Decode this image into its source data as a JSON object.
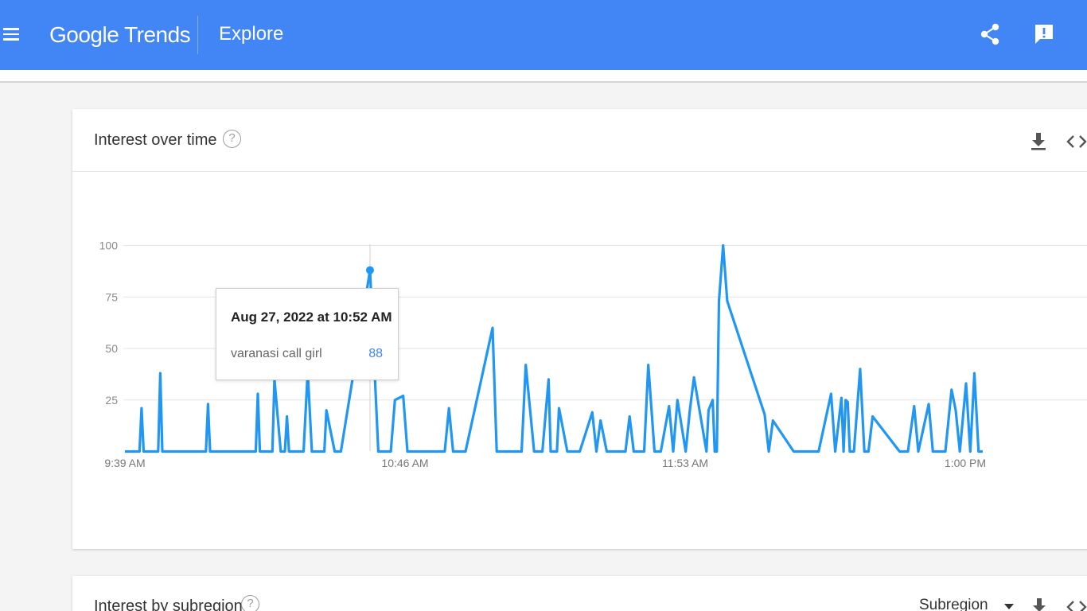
{
  "header": {
    "logo_google": "Google",
    "logo_trends": "Trends",
    "section": "Explore",
    "brand_color": "#4285f4",
    "icons": [
      "menu-icon",
      "share-icon",
      "feedback-icon"
    ]
  },
  "interest_card": {
    "title": "Interest over time",
    "help_symbol": "?",
    "icons": [
      "download-icon",
      "embed-icon"
    ]
  },
  "tooltip": {
    "date": "Aug 27, 2022 at 10:52 AM",
    "term": "varanasi call girl",
    "value": "88"
  },
  "chart_data": {
    "type": "line",
    "xlabel": "",
    "ylabel": "",
    "ylim": [
      0,
      100
    ],
    "y_ticks": [
      "100",
      "75",
      "50",
      "25"
    ],
    "x_ticks": [
      "9:39 AM",
      "10:46 AM",
      "11:53 AM",
      "1:00 PM"
    ],
    "grid": true,
    "color": "#2196f3",
    "highlighted_point": {
      "x": 731,
      "y": 88
    },
    "x": [
      0,
      7,
      8,
      9,
      16,
      17,
      18,
      35,
      39,
      40,
      41,
      44,
      61,
      63,
      64,
      65,
      69,
      71,
      72,
      75,
      77,
      78,
      79,
      80,
      81,
      82,
      86,
      88,
      90,
      93,
      94,
      96,
      97,
      101,
      103,
      104,
      118,
      122,
      124,
      128,
      130,
      134,
      136,
      140,
      154,
      156,
      158,
      160,
      162,
      164,
      177,
      179,
      181,
      189,
      191,
      193,
      197,
      200,
      201,
      204,
      205,
      206,
      208,
      209,
      213,
      217,
      219,
      225,
      227,
      229,
      232,
      234,
      238,
      241,
      243,
      245,
      248,
      250,
      252,
      255,
      258,
      262,
      264,
      266,
      270,
      272,
      274,
      280,
      281,
      283,
      284,
      285,
      286,
      288,
      290,
      308,
      310,
      312,
      322,
      324,
      332,
      334,
      340,
      342,
      345,
      346,
      347,
      348,
      349,
      350,
      351,
      354,
      356,
      358,
      360,
      373,
      375,
      377,
      380,
      382,
      387,
      389,
      393,
      395,
      398,
      400,
      402,
      405,
      407,
      409,
      411,
      413,
      418,
      420,
      422,
      423,
      425,
      427,
      429,
      431,
      432,
      434,
      438,
      440,
      442,
      444,
      445,
      446,
      448,
      450,
      452
    ],
    "y": [
      0,
      0,
      21,
      0,
      0,
      38,
      0,
      0,
      0,
      23,
      0,
      0,
      0,
      0,
      28,
      0,
      0,
      0,
      35,
      0,
      0,
      17,
      0,
      0,
      0,
      0,
      0,
      39,
      0,
      0,
      0,
      0,
      20,
      0,
      0,
      0,
      88,
      0,
      0,
      0,
      25,
      27,
      0,
      0,
      0,
      21,
      0,
      0,
      0,
      0,
      60,
      0,
      0,
      0,
      0,
      42,
      0,
      0,
      0,
      35,
      0,
      0,
      0,
      21,
      0,
      0,
      0,
      19,
      0,
      15,
      0,
      0,
      0,
      0,
      17,
      0,
      0,
      0,
      42,
      0,
      0,
      22,
      0,
      25,
      0,
      20,
      36,
      0,
      20,
      25,
      0,
      0,
      73,
      100,
      73,
      18,
      0,
      15,
      0,
      0,
      0,
      0,
      28,
      0,
      26,
      0,
      25,
      24,
      0,
      0,
      0,
      40,
      0,
      0,
      17,
      0,
      0,
      0,
      22,
      0,
      23,
      0,
      0,
      0,
      30,
      20,
      0,
      33,
      0,
      38,
      0,
      0
    ],
    "series": [
      {
        "name": "varanasi call girl",
        "values_ref": "y"
      }
    ]
  },
  "subregion_card": {
    "title": "Interest by subregion",
    "help_symbol": "?",
    "select_value": "Subregion",
    "icons": [
      "download-icon",
      "embed-icon"
    ]
  }
}
